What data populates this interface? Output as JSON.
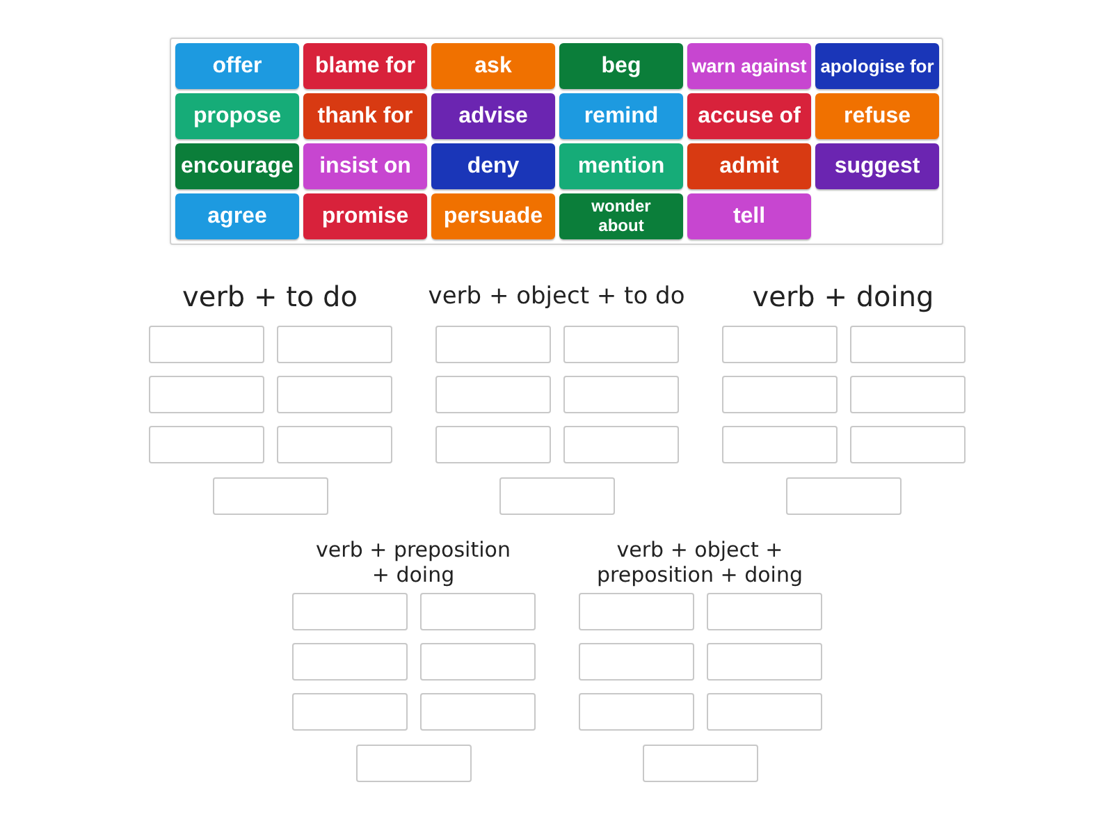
{
  "word_bank": {
    "tiles": [
      {
        "label": "offer",
        "color": "#1d9ae0"
      },
      {
        "label": "blame for",
        "color": "#d8223b"
      },
      {
        "label": "ask",
        "color": "#f07100"
      },
      {
        "label": "beg",
        "color": "#0b7e3a"
      },
      {
        "label": "warn against",
        "color": "#c746d0"
      },
      {
        "label": "apologise for",
        "color": "#1a36b8"
      },
      {
        "label": "propose",
        "color": "#16ac78"
      },
      {
        "label": "thank for",
        "color": "#d83a12"
      },
      {
        "label": "advise",
        "color": "#6b25b1"
      },
      {
        "label": "remind",
        "color": "#1d9ae0"
      },
      {
        "label": "accuse of",
        "color": "#d8223b"
      },
      {
        "label": "refuse",
        "color": "#f07100"
      },
      {
        "label": "encourage",
        "color": "#0b7e3a"
      },
      {
        "label": "insist on",
        "color": "#c746d0"
      },
      {
        "label": "deny",
        "color": "#1a36b8"
      },
      {
        "label": "mention",
        "color": "#16ac78"
      },
      {
        "label": "admit",
        "color": "#d83a12"
      },
      {
        "label": "suggest",
        "color": "#6b25b1"
      },
      {
        "label": "agree",
        "color": "#1d9ae0"
      },
      {
        "label": "promise",
        "color": "#d8223b"
      },
      {
        "label": "persuade",
        "color": "#f07100"
      },
      {
        "label": "wonder about",
        "color": "#0b7e3a"
      },
      {
        "label": "tell",
        "color": "#c746d0"
      }
    ]
  },
  "groups": [
    {
      "title": "verb + to do",
      "boxes": [
        {
          "empty": true
        },
        {
          "empty": true
        },
        {
          "empty": true
        },
        {
          "empty": true
        },
        {
          "empty": true
        },
        {
          "empty": true
        },
        {
          "empty": true
        }
      ]
    },
    {
      "title": "verb + object + to do",
      "boxes": [
        {
          "empty": true
        },
        {
          "empty": true
        },
        {
          "empty": true
        },
        {
          "empty": true
        },
        {
          "empty": true
        },
        {
          "empty": true
        },
        {
          "empty": true
        }
      ]
    },
    {
      "title": "verb + doing",
      "boxes": [
        {
          "empty": true
        },
        {
          "empty": true
        },
        {
          "empty": true
        },
        {
          "empty": true
        },
        {
          "empty": true
        },
        {
          "empty": true
        },
        {
          "empty": true
        }
      ]
    },
    {
      "title": "verb + preposition + doing",
      "boxes": [
        {
          "empty": true
        },
        {
          "empty": true
        },
        {
          "empty": true
        },
        {
          "empty": true
        },
        {
          "empty": true
        },
        {
          "empty": true
        },
        {
          "empty": true
        }
      ]
    },
    {
      "title": "verb + object + preposition + doing",
      "boxes": [
        {
          "empty": true
        },
        {
          "empty": true
        },
        {
          "empty": true
        },
        {
          "empty": true
        },
        {
          "empty": true
        },
        {
          "empty": true
        },
        {
          "empty": true
        }
      ]
    }
  ]
}
